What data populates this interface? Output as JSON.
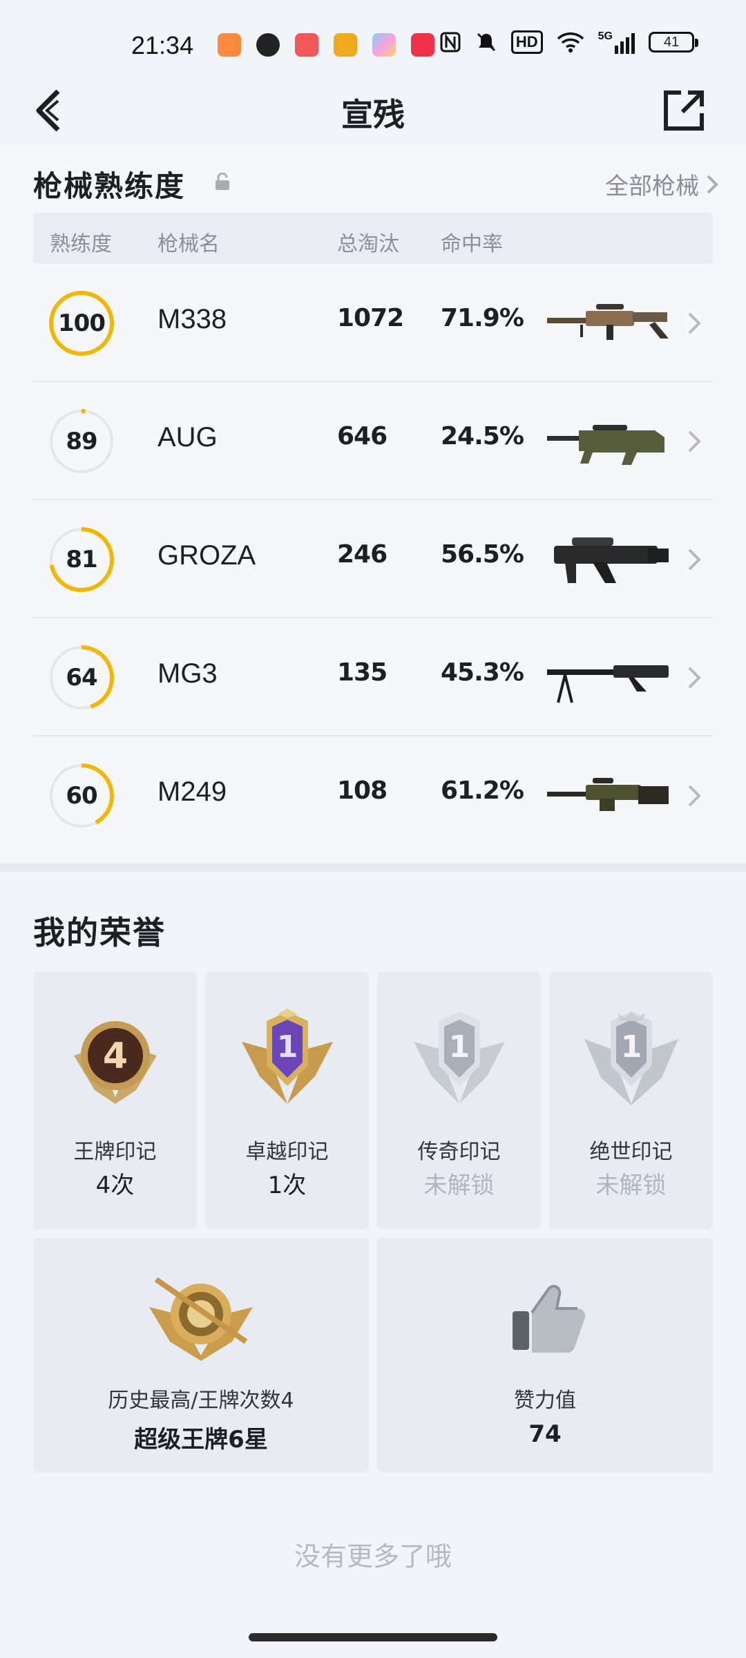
{
  "status_bar": {
    "time": "21:34",
    "battery": "41",
    "icons": [
      "game-controller-icon",
      "qq-icon",
      "video-icon",
      "coin-icon",
      "gallery-icon",
      "music-icon",
      "nfc-icon",
      "mute-icon",
      "hd-icon",
      "wifi-icon",
      "signal-5g-icon",
      "battery-icon"
    ],
    "hd_label": "HD",
    "net_label": "5G"
  },
  "nav": {
    "title": "宣残"
  },
  "weapons": {
    "section_title": "枪械熟练度",
    "all_link": "全部枪械",
    "headers": {
      "proficiency": "熟练度",
      "name": "枪械名",
      "kills": "总淘汰",
      "hitrate": "命中率"
    },
    "rows": [
      {
        "proficiency": "100",
        "name": "M338",
        "kills": "1072",
        "hitrate": "71.9%",
        "progress": 1.0
      },
      {
        "proficiency": "89",
        "name": "AUG",
        "kills": "646",
        "hitrate": "24.5%",
        "progress": 0.02
      },
      {
        "proficiency": "81",
        "name": "GROZA",
        "kills": "246",
        "hitrate": "56.5%",
        "progress": 0.72
      },
      {
        "proficiency": "64",
        "name": "MG3",
        "kills": "135",
        "hitrate": "45.3%",
        "progress": 0.45
      },
      {
        "proficiency": "60",
        "name": "M249",
        "kills": "108",
        "hitrate": "61.2%",
        "progress": 0.42
      }
    ],
    "accent": "#f2b705",
    "ring_track": "#e3e6eb"
  },
  "honors": {
    "section_title": "我的荣誉",
    "cards": [
      {
        "name": "王牌印记",
        "count": "4次",
        "badge_text": "4",
        "locked": false
      },
      {
        "name": "卓越印记",
        "count": "1次",
        "badge_text": "1",
        "locked": false
      },
      {
        "name": "传奇印记",
        "count": "未解锁",
        "badge_text": "1",
        "locked": true
      },
      {
        "name": "绝世印记",
        "count": "未解锁",
        "badge_text": "1",
        "locked": true
      }
    ],
    "best": {
      "label": "历史最高/王牌次数4",
      "value": "超级王牌6星"
    },
    "likes": {
      "label": "赞力值",
      "value": "74"
    }
  },
  "footer": {
    "no_more": "没有更多了哦"
  }
}
